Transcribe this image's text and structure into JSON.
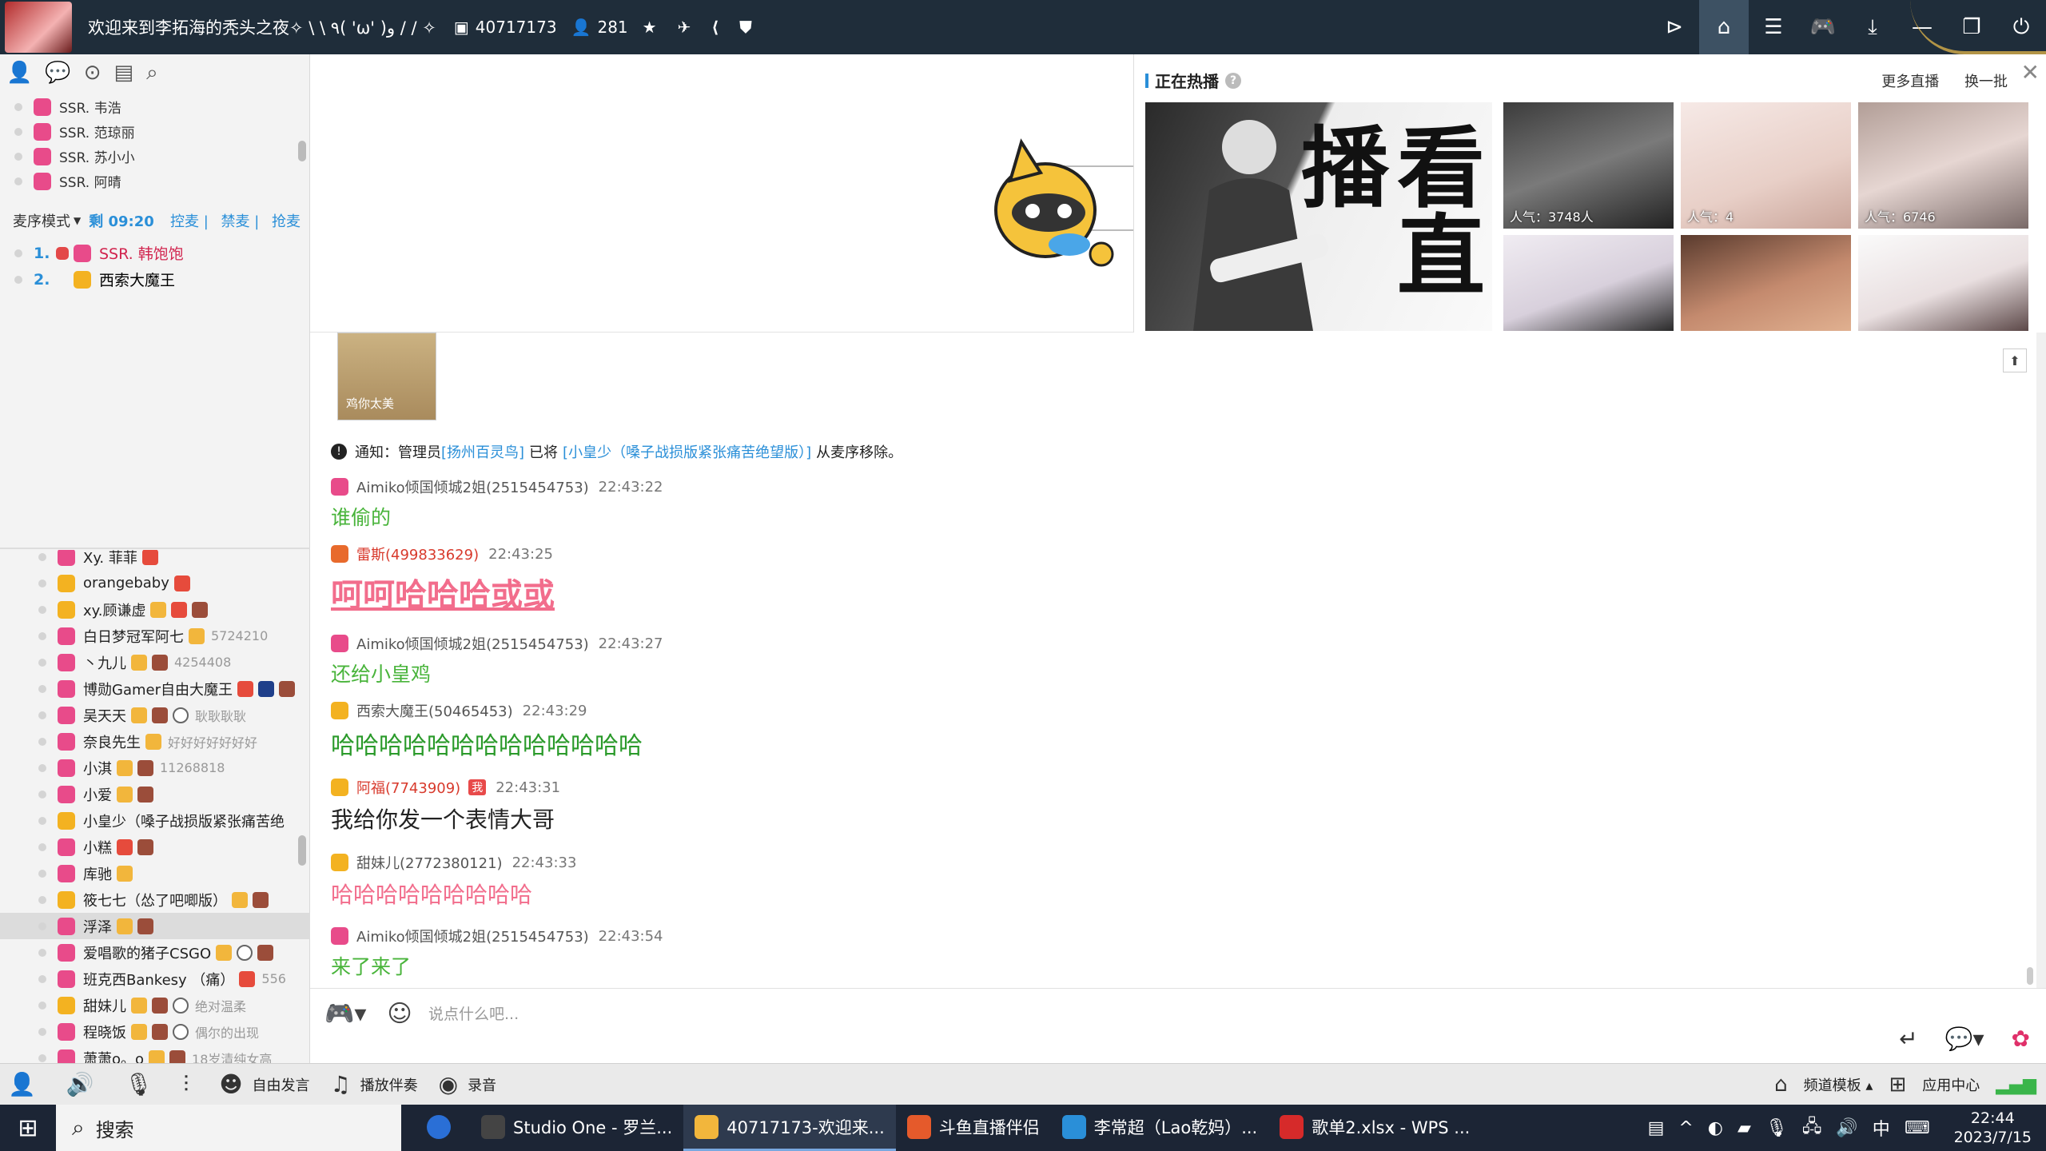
{
  "topbar": {
    "title": "欢迎来到李拓海的秃头之夜✧ \\ \\ ٩( 'ω' )و / / ✧",
    "room_id": "40717173",
    "online_count": "281",
    "icons": [
      "room-icon",
      "user-icon",
      "star-icon",
      "plane-icon",
      "share-icon",
      "shield-icon"
    ],
    "right_icons": [
      "live-icon",
      "home-icon",
      "list-icon",
      "gamepad-icon",
      "download-icon",
      "minimize-icon",
      "restore-icon",
      "power-icon"
    ]
  },
  "sidebar": {
    "toolbar_icons": [
      "profile-icon",
      "chat-icon",
      "location-icon",
      "album-icon",
      "search-icon"
    ],
    "mic_top": [
      {
        "name": "SSR. 韦浩"
      },
      {
        "name": "SSR. 范琼丽"
      },
      {
        "name": "SSR. 苏小小"
      },
      {
        "name": "SSR. 阿晴"
      }
    ],
    "queue_mode": "麦序模式",
    "queue_time": "剩 09:20",
    "queue_ops": [
      "控麦",
      "禁麦",
      "抢麦"
    ],
    "queue": [
      {
        "idx": "1.",
        "name": "SSR. 韩饱饱"
      },
      {
        "idx": "2.",
        "name": "西索大魔王"
      }
    ],
    "users": [
      {
        "name": "Xy. 菲菲",
        "note": ""
      },
      {
        "name": "orangebaby",
        "note": ""
      },
      {
        "name": "xy.顾谦虚",
        "note": ""
      },
      {
        "name": "白日梦冠军阿七",
        "note": "5724210"
      },
      {
        "name": "丶九儿",
        "note": "4254408"
      },
      {
        "name": "博勋Gamer自由大魔王",
        "note": ""
      },
      {
        "name": "吴天天",
        "note": "耿耿耿耿"
      },
      {
        "name": "奈良先生",
        "note": "好好好好好好好"
      },
      {
        "name": "小淇",
        "note": "11268818"
      },
      {
        "name": "小爱",
        "note": ""
      },
      {
        "name": "小皇少（嗓子战损版紧张痛苦绝",
        "note": ""
      },
      {
        "name": "小糕",
        "note": ""
      },
      {
        "name": "库驰",
        "note": ""
      },
      {
        "name": "筱七七（怂了吧唧版）",
        "note": ""
      },
      {
        "name": "浮泽",
        "note": ""
      },
      {
        "name": "爱唱歌的猪子CSGO",
        "note": ""
      },
      {
        "name": "班克西Bankesy （痛）",
        "note": "556"
      },
      {
        "name": "甜妹儿",
        "note": "绝对温柔"
      },
      {
        "name": "程晓饭",
        "note": "偶尔的出现"
      },
      {
        "name": "萧萧o。o",
        "note": "18岁清纯女高"
      }
    ]
  },
  "hot": {
    "title": "正在热播",
    "more_label": "更多直播",
    "change_label": "换一批",
    "feature_text": "看直播",
    "thumbs": [
      {
        "pop": "人气：3748人"
      },
      {
        "pop": "人气：4"
      },
      {
        "pop": "人气：6746"
      },
      {
        "pop": ""
      },
      {
        "pop": ""
      },
      {
        "pop": ""
      }
    ]
  },
  "chat": {
    "sticker_caption": "鸡你太美",
    "notice": {
      "prefix": "通知：管理员",
      "admin": "[扬州百灵鸟]",
      "mid": "已将",
      "target": "[小皇少（嗓子战损版紧张痛苦绝望版）]",
      "suffix": "从麦序移除。"
    },
    "messages": [
      {
        "name": "Aimiko倾国倾城2姐(2515454753)",
        "time": "22:43:22",
        "text": "谁偷的"
      },
      {
        "name": "雷斯(499833629)",
        "time": "22:43:25",
        "text": "呵呵哈哈哈或或"
      },
      {
        "name": "Aimiko倾国倾城2姐(2515454753)",
        "time": "22:43:27",
        "text": "还给小皇鸡"
      },
      {
        "name": "西索大魔王(50465453)",
        "time": "22:43:29",
        "text": "哈哈哈哈哈哈哈哈哈哈哈哈哈"
      },
      {
        "name": "阿福(7743909)",
        "time": "22:43:31",
        "tag": "我",
        "text": "我给你发一个表情大哥"
      },
      {
        "name": "甜妹儿(2772380121)",
        "time": "22:43:33",
        "text": "哈哈哈哈哈哈哈哈哈"
      },
      {
        "name": "Aimiko倾国倾城2姐(2515454753)",
        "time": "22:43:54",
        "text": "来了来了"
      }
    ]
  },
  "input": {
    "placeholder": "说点什么吧..."
  },
  "bottombar": {
    "free_speak": "自由发言",
    "play_music": "播放伴奏",
    "record": "录音",
    "channel_template": "频道模板",
    "app_center": "应用中心"
  },
  "taskbar": {
    "search_label": "搜索",
    "apps": [
      {
        "label": "",
        "color": "#2a6fd6"
      },
      {
        "label": "Studio One - 罗兰...",
        "color": "#444444"
      },
      {
        "label": "40717173-欢迎来...",
        "color": "#f2b63c",
        "active": true
      },
      {
        "label": "斗鱼直播伴侣",
        "color": "#e55a2b"
      },
      {
        "label": "李常超（Lao乾妈）...",
        "color": "#2a8fd8"
      },
      {
        "label": "歌单2.xlsx - WPS ...",
        "color": "#d62a2a"
      }
    ],
    "ime": "中",
    "time": "22:44",
    "date": "2023/7/15"
  }
}
